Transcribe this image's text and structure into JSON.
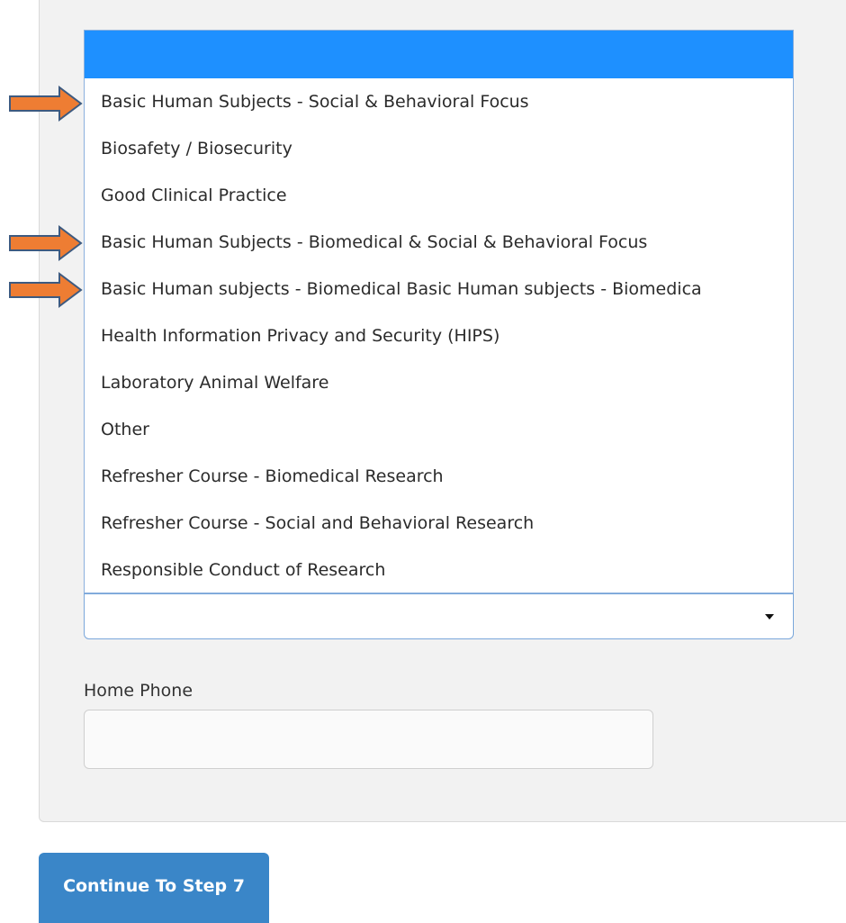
{
  "dropdown": {
    "options": [
      "",
      "Basic Human Subjects - Social & Behavioral Focus",
      "Biosafety / Biosecurity",
      "Good Clinical Practice",
      "Basic Human Subjects - Biomedical & Social & Behavioral Focus",
      "Basic Human subjects - Biomedical Basic Human subjects - Biomedica",
      "Health Information Privacy and Security (HIPS)",
      "Laboratory Animal Welfare",
      "Other",
      "Refresher Course - Biomedical Research",
      "Refresher Course - Social and Behavioral Research",
      "Responsible Conduct of Research"
    ],
    "selected_value": ""
  },
  "form": {
    "home_phone_label": "Home Phone",
    "home_phone_value": ""
  },
  "buttons": {
    "continue_label": "Continue To Step 7"
  },
  "annotations": {
    "arrow_color": "#ee7d33",
    "arrow_outline": "#3d5a80",
    "arrow_targets": [
      1,
      4,
      5
    ]
  },
  "colors": {
    "highlight": "#1e90ff",
    "button": "#3a86c8"
  }
}
